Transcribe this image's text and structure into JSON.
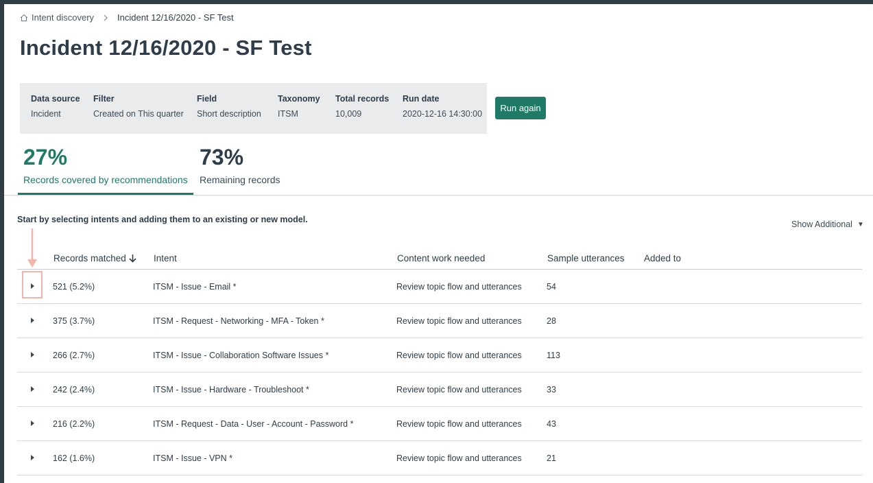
{
  "breadcrumb": {
    "home_label": "Intent discovery",
    "current": "Incident 12/16/2020 - SF Test"
  },
  "page_title": "Incident 12/16/2020 - SF Test",
  "summary": [
    {
      "label": "Data source",
      "value": "Incident"
    },
    {
      "label": "Filter",
      "value": "Created on This quarter"
    },
    {
      "label": "Field",
      "value": "Short description"
    },
    {
      "label": "Taxonomy",
      "value": "ITSM"
    },
    {
      "label": "Total records",
      "value": "10,009"
    },
    {
      "label": "Run date",
      "value": "2020-12-16 14:30:00"
    }
  ],
  "run_again_label": "Run again",
  "stats": [
    {
      "percent": "27%",
      "label": "Records covered by recommendations",
      "active": true
    },
    {
      "percent": "73%",
      "label": "Remaining records",
      "active": false
    }
  ],
  "instruction": "Start by selecting intents and adding them to an existing or new model.",
  "show_additional": "Show Additional",
  "table": {
    "headers": {
      "records": "Records matched",
      "intent": "Intent",
      "content": "Content work needed",
      "samples": "Sample utterances",
      "added": "Added to"
    },
    "rows": [
      {
        "records": "521 (5.2%)",
        "intent": "ITSM - Issue - Email *",
        "content": "Review topic flow and utterances",
        "samples": "54",
        "added": ""
      },
      {
        "records": "375 (3.7%)",
        "intent": "ITSM - Request - Networking - MFA - Token *",
        "content": "Review topic flow and utterances",
        "samples": "28",
        "added": ""
      },
      {
        "records": "266 (2.7%)",
        "intent": "ITSM - Issue - Collaboration Software Issues *",
        "content": "Review topic flow and utterances",
        "samples": "113",
        "added": ""
      },
      {
        "records": "242 (2.4%)",
        "intent": "ITSM - Issue - Hardware - Troubleshoot *",
        "content": "Review topic flow and utterances",
        "samples": "33",
        "added": ""
      },
      {
        "records": "216 (2.2%)",
        "intent": "ITSM - Request - Data - User - Account - Password *",
        "content": "Review topic flow and utterances",
        "samples": "43",
        "added": ""
      },
      {
        "records": "162 (1.6%)",
        "intent": "ITSM - Issue - VPN *",
        "content": "Review topic flow and utterances",
        "samples": "21",
        "added": ""
      }
    ]
  },
  "colors": {
    "accent": "#1f7a68",
    "annotation": "#f2b5ab",
    "summary_bg": "#e9ebed"
  },
  "icons": {
    "home": "home-icon",
    "separator": "chevron-right-icon",
    "sort": "arrow-down-icon",
    "expand": "caret-right-icon",
    "dropdown": "caret-down-icon"
  }
}
